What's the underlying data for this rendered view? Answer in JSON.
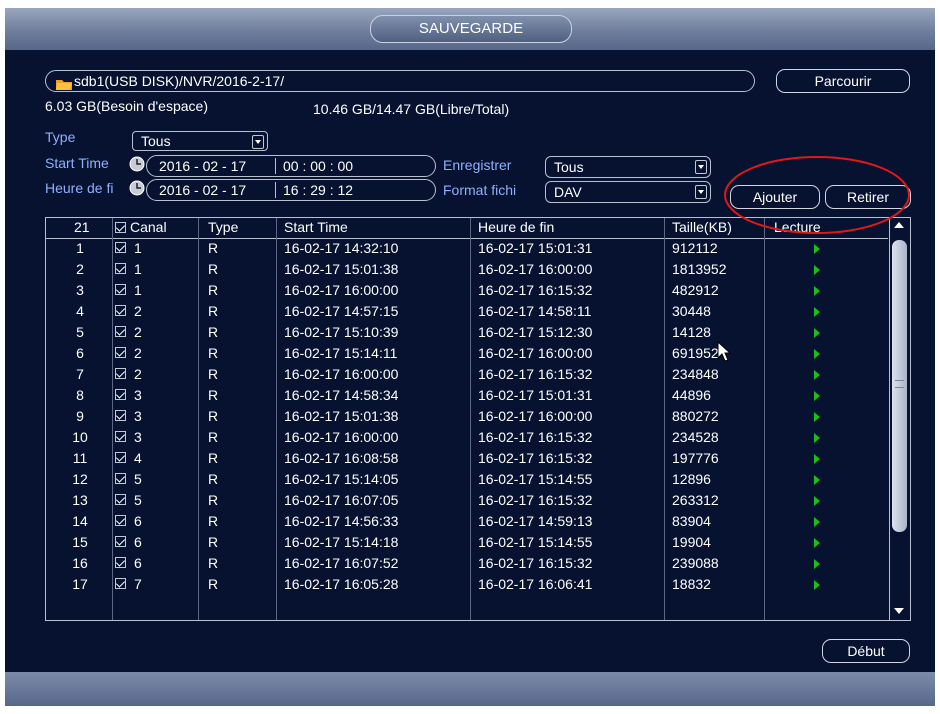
{
  "window": {
    "title": "SAUVEGARDE"
  },
  "device": {
    "path": "sdb1(USB DISK)/NVR/2016-2-17/",
    "browse_label": "Parcourir"
  },
  "space": {
    "needed": "6.03 GB(Besoin d'espace)",
    "free_total": "10.46 GB/14.47 GB(Libre/Total)"
  },
  "filters": {
    "type_label": "Type",
    "type_value": "Tous",
    "start_label": "Start Time",
    "start_date": "2016 - 02 - 17",
    "start_time": "00 : 00 : 00",
    "end_label": "Heure de fi",
    "end_date": "2016 - 02 - 17",
    "end_time": "16 : 29 : 12",
    "record_label": "Enregistrer",
    "record_value": "Tous",
    "format_label": "Format fichi",
    "format_value": "DAV"
  },
  "actions": {
    "add_label": "Ajouter",
    "remove_label": "Retirer",
    "start_label": "Début"
  },
  "table": {
    "headers": {
      "count": "21",
      "channel": "Canal",
      "type": "Type",
      "start": "Start Time",
      "end": "Heure de fin",
      "size": "Taille(KB)",
      "play": "Lecture"
    },
    "rows": [
      {
        "n": "1",
        "ch": "1",
        "type": "R",
        "start": "16-02-17 14:32:10",
        "end": "16-02-17 15:01:31",
        "size": "912112"
      },
      {
        "n": "2",
        "ch": "1",
        "type": "R",
        "start": "16-02-17 15:01:38",
        "end": "16-02-17 16:00:00",
        "size": "1813952"
      },
      {
        "n": "3",
        "ch": "1",
        "type": "R",
        "start": "16-02-17 16:00:00",
        "end": "16-02-17 16:15:32",
        "size": "482912"
      },
      {
        "n": "4",
        "ch": "2",
        "type": "R",
        "start": "16-02-17 14:57:15",
        "end": "16-02-17 14:58:11",
        "size": "30448"
      },
      {
        "n": "5",
        "ch": "2",
        "type": "R",
        "start": "16-02-17 15:10:39",
        "end": "16-02-17 15:12:30",
        "size": "14128"
      },
      {
        "n": "6",
        "ch": "2",
        "type": "R",
        "start": "16-02-17 15:14:11",
        "end": "16-02-17 16:00:00",
        "size": "691952"
      },
      {
        "n": "7",
        "ch": "2",
        "type": "R",
        "start": "16-02-17 16:00:00",
        "end": "16-02-17 16:15:32",
        "size": "234848"
      },
      {
        "n": "8",
        "ch": "3",
        "type": "R",
        "start": "16-02-17 14:58:34",
        "end": "16-02-17 15:01:31",
        "size": "44896"
      },
      {
        "n": "9",
        "ch": "3",
        "type": "R",
        "start": "16-02-17 15:01:38",
        "end": "16-02-17 16:00:00",
        "size": "880272"
      },
      {
        "n": "10",
        "ch": "3",
        "type": "R",
        "start": "16-02-17 16:00:00",
        "end": "16-02-17 16:15:32",
        "size": "234528"
      },
      {
        "n": "11",
        "ch": "4",
        "type": "R",
        "start": "16-02-17 16:08:58",
        "end": "16-02-17 16:15:32",
        "size": "197776"
      },
      {
        "n": "12",
        "ch": "5",
        "type": "R",
        "start": "16-02-17 15:14:05",
        "end": "16-02-17 15:14:55",
        "size": "12896"
      },
      {
        "n": "13",
        "ch": "5",
        "type": "R",
        "start": "16-02-17 16:07:05",
        "end": "16-02-17 16:15:32",
        "size": "263312"
      },
      {
        "n": "14",
        "ch": "6",
        "type": "R",
        "start": "16-02-17 14:56:33",
        "end": "16-02-17 14:59:13",
        "size": "83904"
      },
      {
        "n": "15",
        "ch": "6",
        "type": "R",
        "start": "16-02-17 15:14:18",
        "end": "16-02-17 15:14:55",
        "size": "19904"
      },
      {
        "n": "16",
        "ch": "6",
        "type": "R",
        "start": "16-02-17 16:07:52",
        "end": "16-02-17 16:15:32",
        "size": "239088"
      },
      {
        "n": "17",
        "ch": "7",
        "type": "R",
        "start": "16-02-17 16:05:28",
        "end": "16-02-17 16:06:41",
        "size": "18832"
      }
    ]
  },
  "colors": {
    "background": "#061230",
    "label_blue": "#8fb0ff",
    "play_green": "#18c018",
    "annotation_red": "#e01818"
  }
}
